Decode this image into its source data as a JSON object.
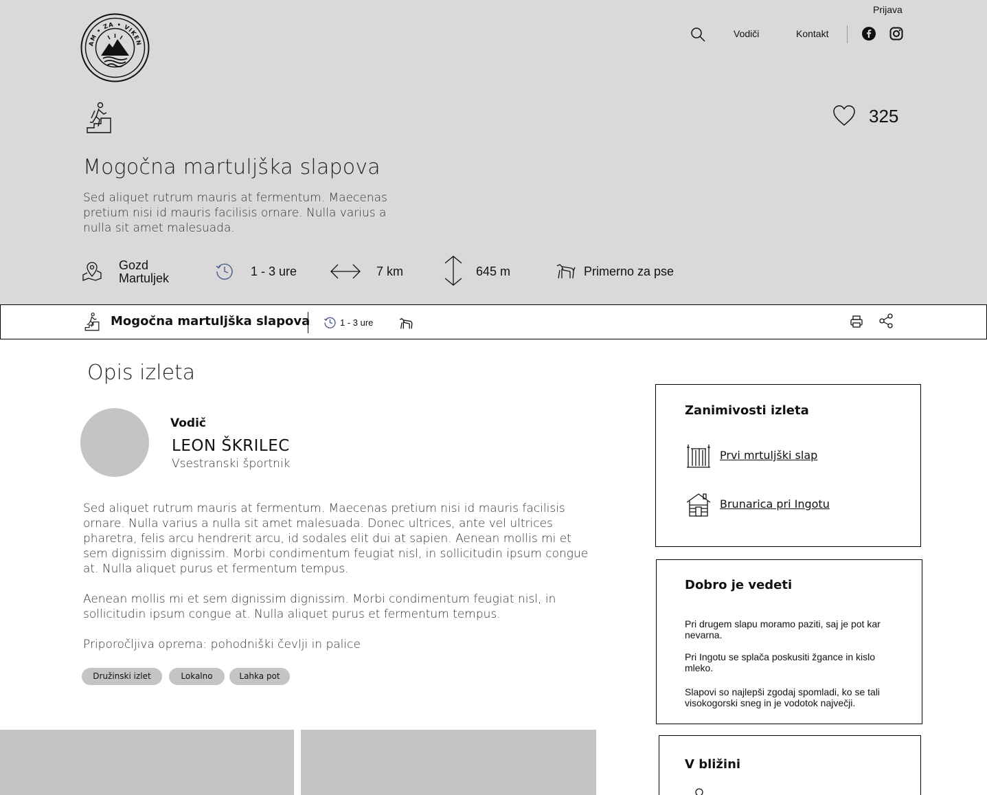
{
  "header": {
    "login_label": "Prijava",
    "nav": {
      "guides_label": "Vodiči",
      "contact_label": "Kontakt"
    },
    "logo_text": "KAM • ZA • VIKEND"
  },
  "hero": {
    "likes": "325",
    "title": "Mogočna martuljška slapova",
    "description": "Sed aliquet rutrum mauris at fermentum. Maecenas pretium nisi id mauris facilisis ornare. Nulla varius a nulla sit amet malesuada.",
    "stats": {
      "location_line1": "Gozd",
      "location_line2": "Martuljek",
      "duration": "1 - 3 ure",
      "distance": "7 km",
      "elevation": "645 m",
      "dogs": "Primerno za pse"
    }
  },
  "sticky_bar": {
    "title": "Mogočna martuljška slapova",
    "duration": "1 - 3 ure"
  },
  "main": {
    "section_title": "Opis izleta",
    "guide": {
      "label": "Vodič",
      "name": "LEON ŠKRILEC",
      "role": "Vsestranski športnik"
    },
    "paragraphs": [
      "Sed aliquet rutrum mauris at fermentum. Maecenas pretium nisi id mauris facilisis ornare. Nulla varius a nulla sit amet malesuada. Donec ultrices, ante vel ultrices pharetra, felis arcu hendrerit arcu, id sodales elit dui at sapien. Aenean mollis mi et sem dignissim dignissim. Morbi condimentum feugiat nisl, in sollicitudin ipsum congue at. Nulla aliquet purus et fermentum tempus.",
      "Aenean mollis mi et sem dignissim dignissim. Morbi condimentum feugiat nisl, in sollicitudin ipsum congue at. Nulla aliquet purus et fermentum tempus.",
      "Priporočljiva oprema: pohodniški čevlji in palice"
    ],
    "tags": [
      "Družinski izlet",
      "Lokalno",
      "Lahka pot"
    ]
  },
  "sidebar": {
    "highlights": {
      "title": "Zanimivosti izleta",
      "items": [
        "Prvi mrtuljški slap",
        "Brunarica pri Ingotu"
      ]
    },
    "good_to_know": {
      "title": "Dobro je vedeti",
      "items": [
        "Pri drugem slapu moramo paziti, saj je pot kar nevarna.",
        "Pri Ingotu se splača poskusiti žgance in kislo mleko.",
        "Slapovi so najlepši zgodaj spomladi, ko se tali visokogorski sneg in je vodotok največji."
      ]
    },
    "nearby": {
      "title": "V bližini"
    }
  }
}
